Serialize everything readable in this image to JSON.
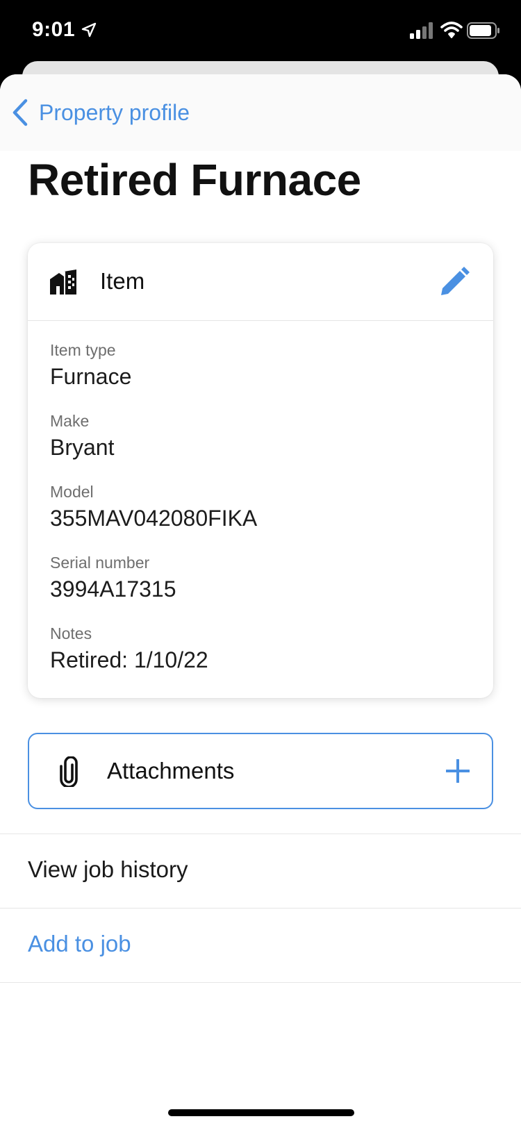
{
  "status_bar": {
    "time": "9:01",
    "icons": [
      "location-arrow-icon",
      "cellular-signal-icon",
      "wifi-icon",
      "battery-icon"
    ]
  },
  "nav": {
    "back_label": "Property profile"
  },
  "page": {
    "title": "Retired Furnace"
  },
  "item_card": {
    "title": "Item",
    "icon": "house-icon",
    "edit_icon": "pencil-icon",
    "fields": [
      {
        "label": "Item type",
        "value": "Furnace"
      },
      {
        "label": "Make",
        "value": "Bryant"
      },
      {
        "label": "Model",
        "value": "355MAV042080FIKA"
      },
      {
        "label": "Serial number",
        "value": "3994A17315"
      },
      {
        "label": "Notes",
        "value": "Retired: 1/10/22"
      }
    ]
  },
  "attachments": {
    "label": "Attachments",
    "icon": "paperclip-icon",
    "add_icon": "plus-icon"
  },
  "actions": {
    "view_job_history": "View job history",
    "add_to_job": "Add to job"
  },
  "colors": {
    "accent": "#4a90e2",
    "text": "#1a1a1a",
    "secondary_text": "#6e6e6e"
  }
}
